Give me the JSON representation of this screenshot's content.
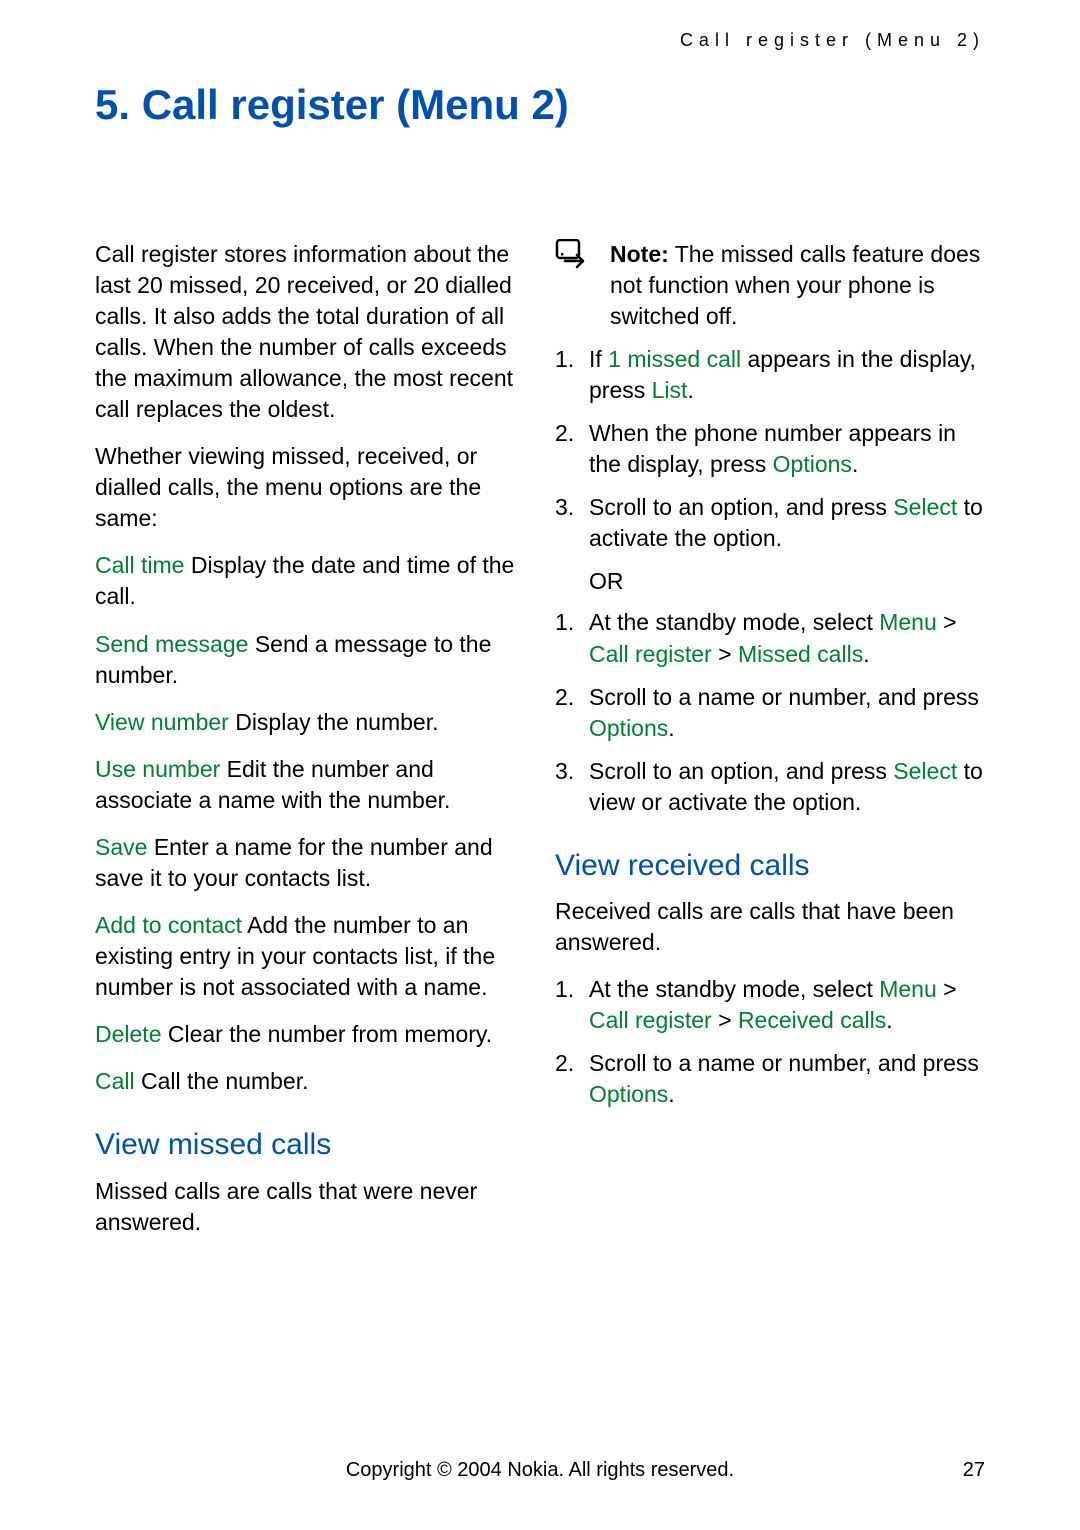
{
  "header": "Call register (Menu 2)",
  "title": "5.  Call register (Menu 2)",
  "left": {
    "intro1": "Call register stores information about the last 20 missed, 20 received, or 20 dialled calls. It also adds the total duration of all calls. When the number of calls exceeds the maximum allowance, the most recent call replaces the oldest.",
    "intro2": "Whether viewing missed, received, or dialled calls, the menu options are the same:",
    "opts": [
      {
        "label": "Call time",
        "desc": " Display the date and time of the call."
      },
      {
        "label": "Send message",
        "desc": " Send a message to the number."
      },
      {
        "label": "View number",
        "desc": " Display the number."
      },
      {
        "label": "Use number",
        "desc": " Edit the number and associate a name with the number."
      },
      {
        "label": "Save",
        "desc": " Enter a name for the number and save it to your contacts list."
      },
      {
        "label": "Add to contact",
        "desc": " Add the number to an existing entry in your contacts list, if the number is not associated with a name."
      },
      {
        "label": "Delete",
        "desc": " Clear the number from memory."
      },
      {
        "label": "Call",
        "desc": " Call the number."
      }
    ],
    "subhead": "View missed calls",
    "missed_desc": "Missed calls are calls that were never answered."
  },
  "right": {
    "note_label": "Note:",
    "note_text": " The missed calls feature does not function when your phone is switched off.",
    "steps_a": [
      {
        "pre": "If ",
        "g": "1 missed call",
        "post": " appears in the display, press ",
        "g2": "List",
        "post2": "."
      },
      {
        "pre": "When the phone number appears in the display, press ",
        "g": "Options",
        "post": ".",
        "g2": "",
        "post2": ""
      },
      {
        "pre": "Scroll to an option, and press ",
        "g": "Select",
        "post": " to activate the option.",
        "g2": "",
        "post2": ""
      }
    ],
    "or": "OR",
    "steps_b": [
      {
        "pre": "At the standby mode, select ",
        "g": "Menu",
        "mid": " > ",
        "g2": "Call register",
        "mid2": " > ",
        "g3": "Missed calls",
        "post": "."
      },
      {
        "pre": "Scroll to a name or number, and press ",
        "g": "Options",
        "mid": "",
        "g2": "",
        "mid2": "",
        "g3": "",
        "post": "."
      },
      {
        "pre": "Scroll to an option, and press ",
        "g": "Select",
        "mid": "",
        "g2": "",
        "mid2": "",
        "g3": "",
        "post": " to view or activate the option."
      }
    ],
    "subhead": "View received calls",
    "recv_pre": "Received calls are ",
    "recv_post": "calls that have been answered.",
    "steps_c": [
      {
        "pre": "At the standby mode, select ",
        "g": "Menu",
        "mid": " > ",
        "g2": "Call register",
        "mid2": " > ",
        "g3": "Received calls",
        "post": "."
      },
      {
        "pre": "Scroll to a name or number, and press ",
        "g": "Options",
        "mid": "",
        "g2": "",
        "mid2": "",
        "g3": "",
        "post": "."
      }
    ]
  },
  "footer": "Copyright © 2004 Nokia. All rights reserved.",
  "page_number": "27"
}
